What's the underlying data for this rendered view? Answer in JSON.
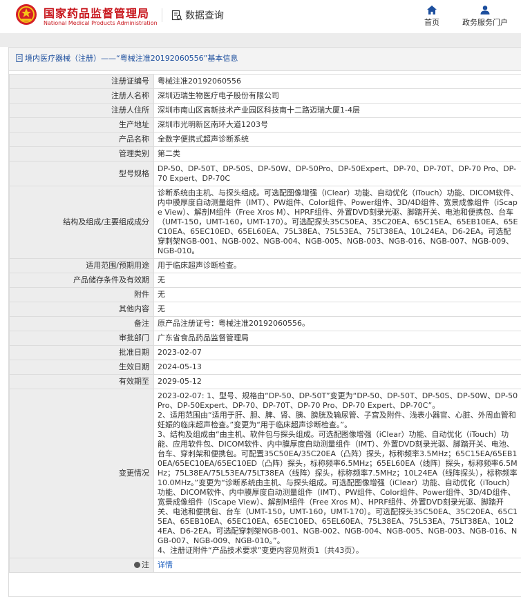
{
  "header": {
    "site_name_cn": "国家药品监督管理局",
    "site_name_en": "National Medical Products Administration",
    "query_label": "数据查询",
    "nav": {
      "home_label": "首页",
      "gov_service_label": "政务服务门户"
    }
  },
  "panel": {
    "breadcrumb_category": "境内医疗器械（注册）",
    "breadcrumb_separator": "——",
    "breadcrumb_title": "“粤械注准20192060556”基本信息"
  },
  "rows": [
    {
      "label": "注册证编号",
      "value": "粤械注准20192060556"
    },
    {
      "label": "注册人名称",
      "value": "深圳迈瑞生物医疗电子股份有限公司"
    },
    {
      "label": "注册人住所",
      "value": "深圳市南山区高新技术产业园区科技南十二路迈瑞大厦1-4层"
    },
    {
      "label": "生产地址",
      "value": "深圳市光明新区南环大道1203号"
    },
    {
      "label": "产品名称",
      "value": "全数字便携式超声诊断系统"
    },
    {
      "label": "管理类别",
      "value": "第二类"
    },
    {
      "label": "型号规格",
      "value": "DP-50、DP-50T、DP-50S、DP-50W、DP-50Pro、DP-50Expert、DP-70、DP-70T、DP-70 Pro、DP-70 Expert、DP-70C"
    },
    {
      "label": "结构及组成/主要组成成分",
      "value": "诊断系统由主机、与探头组成。可选配图像增强（iClear）功能、自动优化（iTouch）功能、DICOM软件、内中膜厚度自动测量组件（IMT）、PW组件、Color组件、Power组件、3D/4D组件、宽景成像组件（iScape View）、解剖M组件（Free Xros M）、HPRF组件、外置DVD刻录光驱、脚踏开关、电池和便携包、台车（UMT-150，UMT-160，UMT-170）。可选配探头35C50EA、35C20EA、65C15EA、65EB10EA、65EC10EA、65EC10ED、65EL60EA、75L38EA、75L53EA、75LT38EA、10L24EA、D6-2EA。可选配穿刺架NGB-001、NGB-002、NGB-004、NGB-005、NGB-003、NGB-016、NGB-007、NGB-009、NGB-010。"
    },
    {
      "label": "适用范围/预期用途",
      "value": "用于临床超声诊断检查。"
    },
    {
      "label": "产品储存条件及有效期",
      "value": "无"
    },
    {
      "label": "附件",
      "value": "无"
    },
    {
      "label": "其他内容",
      "value": "无"
    },
    {
      "label": "备注",
      "value": "原产品注册证号：粤械注准20192060556。"
    },
    {
      "label": "审批部门",
      "value": "广东省食品药品监督管理局"
    },
    {
      "label": "批准日期",
      "value": "2023-02-07"
    },
    {
      "label": "生效日期",
      "value": "2024-05-13"
    },
    {
      "label": "有效期至",
      "value": "2029-05-12"
    }
  ],
  "changes": {
    "label": "变更情况",
    "items": [
      "2023-02-07: 1、型号、规格由“DP-50、DP-50T”变更为“DP-50、DP-50T、DP-50S、DP-50W、DP-50Pro、DP-50Expert、DP-70、DP-70T、DP-70 Pro、DP-70 Expert、DP-70C”。",
      "2、适用范围由“适用于肝、胆、脾、肾、胰、膀胱及输尿管、子宫及附件、浅表小器官、心脏、外周血管和妊娠的临床超声检查。”变更为“用于临床超声诊断检查。”。",
      "3、结构及组成由“由主机、软件包与探头组成。可选配图像增强（iClear）功能、自动优化（iTouch）功能、应用软件包、DICOM软件、内中膜厚度自动测量组件（IMT）、外置DVD刻录光驱、脚踏开关、电池、台车、穿刺架和便携包。可配置35C50EA/35C20EA（凸阵）探头，标称频率3.5MHz；65C15EA/65EB10EA/65EC10EA/65EC10ED（凸阵）探头，标称频率6.5MHz；65EL60EA（线阵）探头，标称频率6.5MHz；75L38EA/75L53EA/75LT38EA（线阵）探头，标称频率7.5MHz；10L24EA（线阵探头），标称频率10.0MHz。”变更为“诊断系统由主机、与探头组成。可选配图像增强（iClear）功能、自动优化（iTouch）功能、DICOM软件、内中膜厚度自动测量组件（IMT）、PW组件、Color组件、Power组件、3D/4D组件、宽景成像组件（iScape View）、解剖M组件（Free Xros M）、HPRF组件、外置DVD刻录光驱、脚踏开关、电池和便携包、台车（UMT-150，UMT-160，UMT-170）。可选配探头35C50EA、35C20EA、65C15EA、65EB10EA、65EC10EA、65EC10ED、65EL60EA、75L38EA、75L53EA、75LT38EA、10L24EA、D6-2EA。可选配穿刺架NGB-001、NGB-002、NGB-004、NGB-005、NGB-003、NGB-016、NGB-007、NGB-009、NGB-010。”。",
      "4、注册证附件“产品技术要求”变更内容见附页1（共43页）。"
    ]
  },
  "notes_row": {
    "label": "注",
    "link_label": "详情"
  },
  "colors": {
    "brand_red": "#c8161d",
    "link_blue": "#1d5fbf",
    "nav_blue": "#1d4f9e"
  }
}
